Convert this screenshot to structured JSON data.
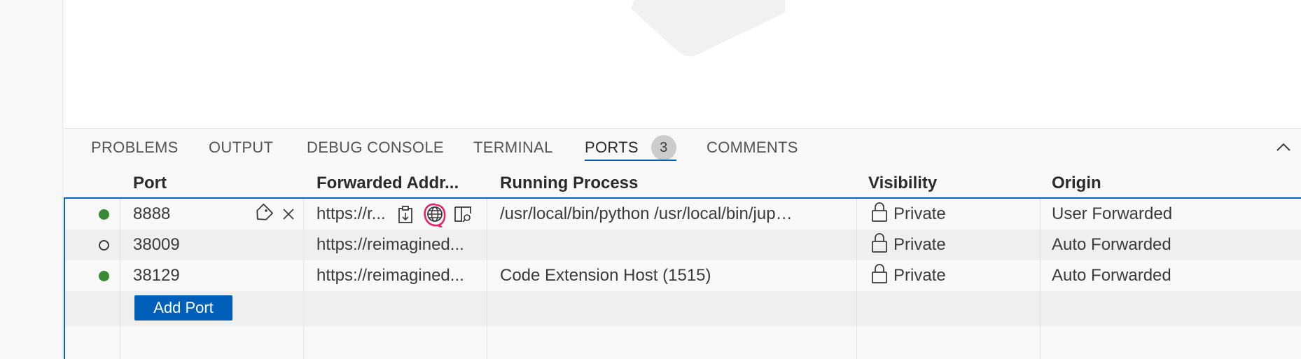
{
  "panel": {
    "tabs": [
      {
        "label": "PROBLEMS"
      },
      {
        "label": "OUTPUT"
      },
      {
        "label": "DEBUG CONSOLE"
      },
      {
        "label": "TERMINAL"
      },
      {
        "label": "PORTS",
        "badge": "3",
        "active": true
      },
      {
        "label": "COMMENTS"
      }
    ]
  },
  "ports_table": {
    "headers": {
      "port": "Port",
      "forwarded_address": "Forwarded Addr...",
      "running_process": "Running Process",
      "visibility": "Visibility",
      "origin": "Origin"
    },
    "rows": [
      {
        "status": "running",
        "port": "8888",
        "forwarded_address": "https://r...",
        "running_process": "/usr/local/bin/python /usr/local/bin/jupyt...",
        "visibility": "Private",
        "origin": "User Forwarded"
      },
      {
        "status": "idle",
        "port": "38009",
        "forwarded_address": "https://reimagined...",
        "running_process": "",
        "visibility": "Private",
        "origin": "Auto Forwarded"
      },
      {
        "status": "running",
        "port": "38129",
        "forwarded_address": "https://reimagined...",
        "running_process": "Code Extension Host (1515)",
        "visibility": "Private",
        "origin": "Auto Forwarded"
      }
    ],
    "add_port_label": "Add Port"
  },
  "icons": {
    "row_actions": [
      "tag-icon",
      "close-icon"
    ],
    "address_actions": [
      "copy-address-icon",
      "globe-icon",
      "preview-in-editor-icon"
    ],
    "visibility": "lock-icon",
    "panel": "chevron-up-icon"
  },
  "colors": {
    "accent": "#005fb8",
    "status_running": "#388a34",
    "annotation": "#e8226a"
  }
}
